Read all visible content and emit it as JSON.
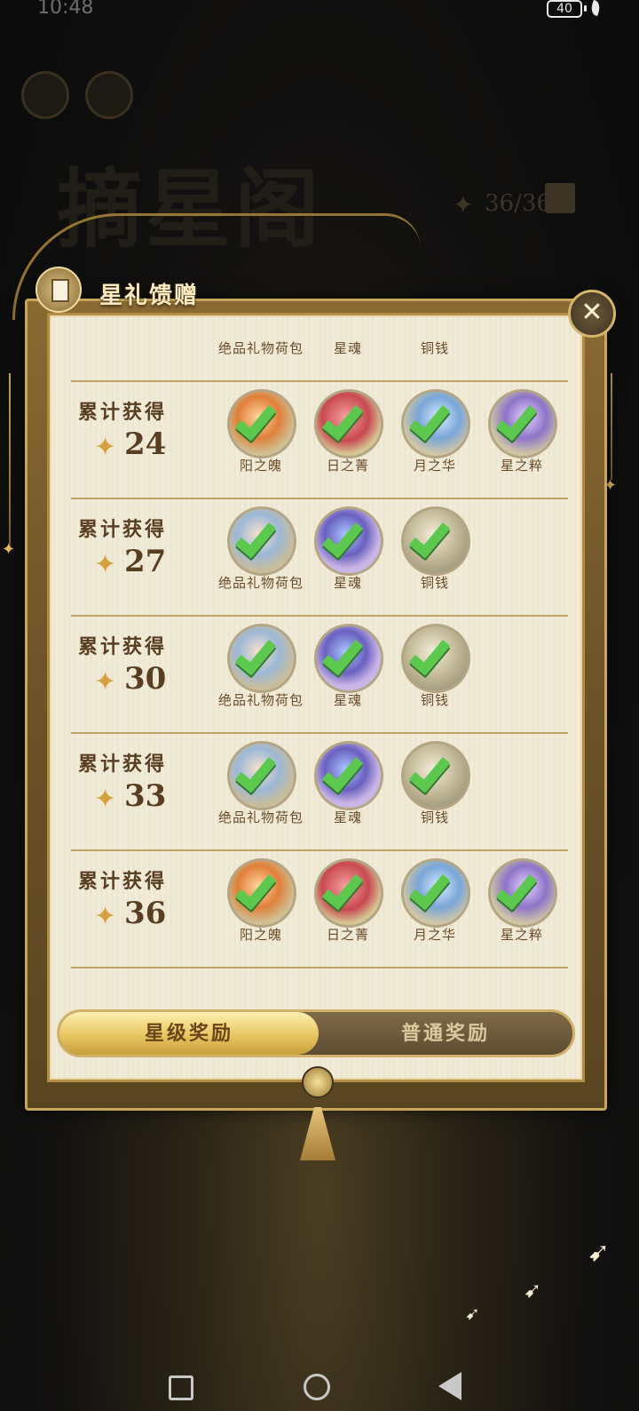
{
  "status": {
    "time": "10:48",
    "battery": "40"
  },
  "background": {
    "title": "摘星阁",
    "progress": "36/36"
  },
  "panel": {
    "title": "星礼馈赠",
    "close_label": "✕"
  },
  "list": {
    "partial_row": {
      "items": [
        "绝品礼物荷包",
        "星魂",
        "铜钱"
      ]
    },
    "rows": [
      {
        "label": "累计获得",
        "count": "24",
        "items": [
          {
            "name": "阳之魄",
            "kind": "orange"
          },
          {
            "name": "日之菁",
            "kind": "red"
          },
          {
            "name": "月之华",
            "kind": "blue"
          },
          {
            "name": "星之粹",
            "kind": "purple"
          }
        ]
      },
      {
        "label": "累计获得",
        "count": "27",
        "items": [
          {
            "name": "绝品礼物荷包",
            "kind": "gift"
          },
          {
            "name": "星魂",
            "kind": "soul"
          },
          {
            "name": "铜钱",
            "kind": "copper"
          }
        ]
      },
      {
        "label": "累计获得",
        "count": "30",
        "items": [
          {
            "name": "绝品礼物荷包",
            "kind": "gift"
          },
          {
            "name": "星魂",
            "kind": "soul"
          },
          {
            "name": "铜钱",
            "kind": "copper"
          }
        ]
      },
      {
        "label": "累计获得",
        "count": "33",
        "items": [
          {
            "name": "绝品礼物荷包",
            "kind": "gift"
          },
          {
            "name": "星魂",
            "kind": "soul"
          },
          {
            "name": "铜钱",
            "kind": "copper"
          }
        ]
      },
      {
        "label": "累计获得",
        "count": "36",
        "items": [
          {
            "name": "阳之魄",
            "kind": "orange"
          },
          {
            "name": "日之菁",
            "kind": "red"
          },
          {
            "name": "月之华",
            "kind": "blue"
          },
          {
            "name": "星之粹",
            "kind": "purple"
          }
        ]
      }
    ]
  },
  "tabs": {
    "active": "星级奖励",
    "inactive": "普通奖励"
  },
  "colors": {
    "accent_gold": "#e7c662",
    "check_green": "#5cc94e",
    "paper": "#f1ecda"
  }
}
